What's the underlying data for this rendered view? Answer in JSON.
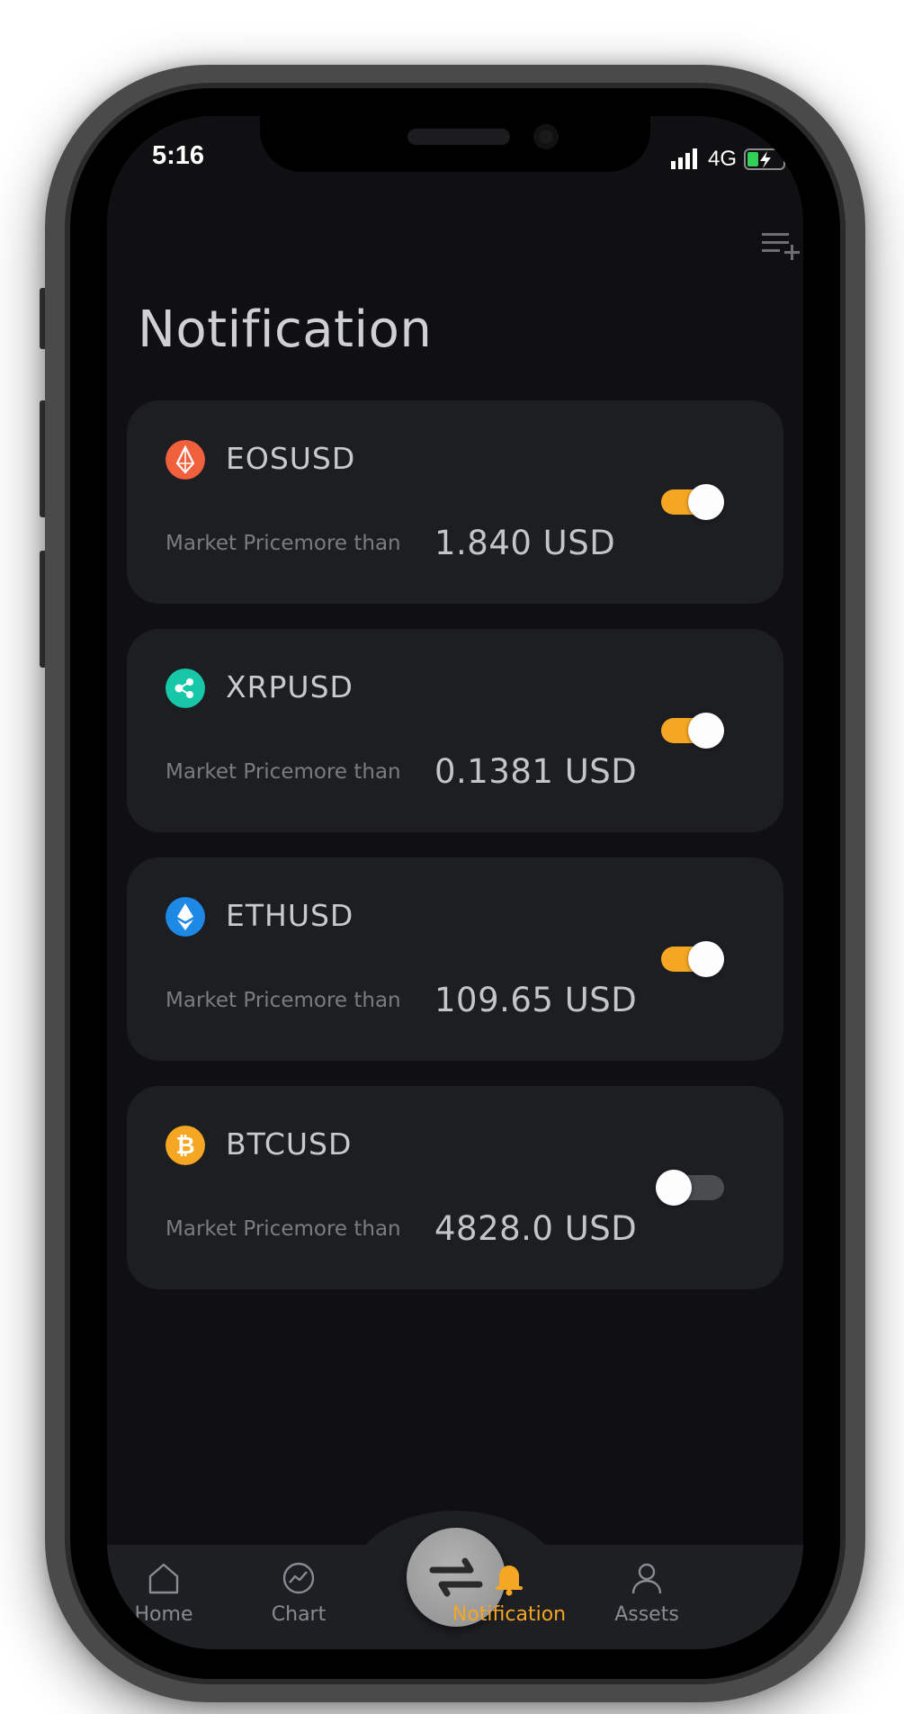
{
  "status_bar": {
    "time": "5:16",
    "network": "4G"
  },
  "page": {
    "title": "Notification"
  },
  "colors": {
    "accent": "#F5A623",
    "card_bg": "#1D1E22",
    "screen_bg": "#101013",
    "toggle_off": "#4A4C50"
  },
  "alerts": [
    {
      "pair": "EOSUSD",
      "icon": "eos-icon",
      "condition": "Market Pricemore than",
      "price": "1.840 USD",
      "enabled": true,
      "icon_color": "#F0603C"
    },
    {
      "pair": "XRPUSD",
      "icon": "xrp-icon",
      "condition": "Market Pricemore than",
      "price": "0.1381 USD",
      "enabled": true,
      "icon_color": "#16C8A8"
    },
    {
      "pair": "ETHUSD",
      "icon": "eth-icon",
      "condition": "Market Pricemore than",
      "price": "109.65 USD",
      "enabled": true,
      "icon_color": "#1E88E5"
    },
    {
      "pair": "BTCUSD",
      "icon": "btc-icon",
      "condition": "Market Pricemore than",
      "price": "4828.0 USD",
      "enabled": false,
      "icon_color": "#F5A623"
    }
  ],
  "tabbar": {
    "items": [
      {
        "label": "Home",
        "icon": "home-icon",
        "active": false
      },
      {
        "label": "Chart",
        "icon": "chart-icon",
        "active": false
      },
      {
        "label": "Notification",
        "icon": "bell-icon",
        "active": true
      },
      {
        "label": "Assets",
        "icon": "user-icon",
        "active": false
      }
    ],
    "center_icon": "swap-icon"
  }
}
